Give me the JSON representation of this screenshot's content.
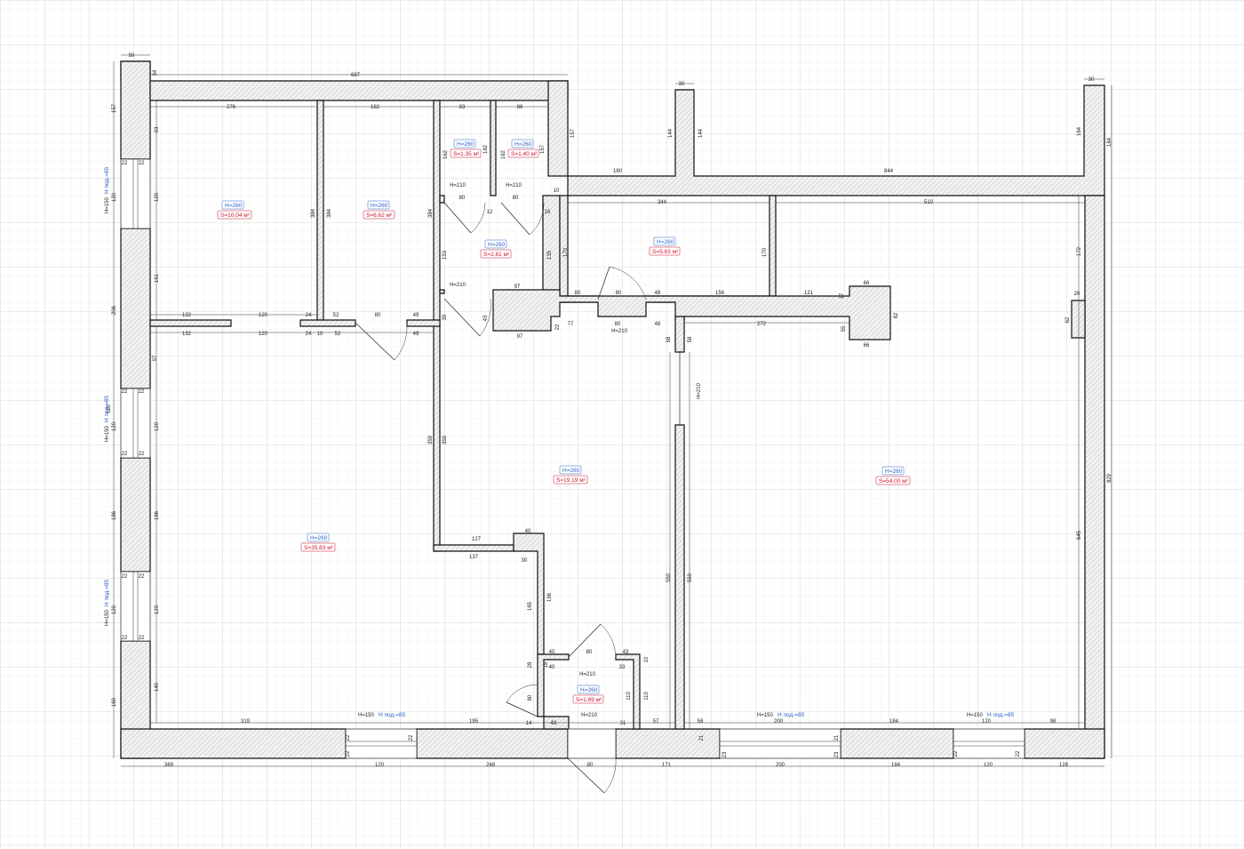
{
  "rooms": [
    {
      "id": "bedroom1",
      "h": "H=260",
      "s": "S=10.04 м²"
    },
    {
      "id": "room2",
      "h": "H=260",
      "s": "S=6.62 м²"
    },
    {
      "id": "wc1",
      "h": "H=260",
      "s": "S=1.35 м²"
    },
    {
      "id": "wc2",
      "h": "H=260",
      "s": "S=1.40 м²"
    },
    {
      "id": "hall-small",
      "h": "H=260",
      "s": "S=2.81 м²"
    },
    {
      "id": "storage",
      "h": "H=260",
      "s": "S=5.83 м²"
    },
    {
      "id": "living",
      "h": "H=260",
      "s": "S=35.83 м²"
    },
    {
      "id": "corridor",
      "h": "H=260",
      "s": "S=19.19 м²"
    },
    {
      "id": "hall-large",
      "h": "H=260",
      "s": "S=54.00 м²"
    },
    {
      "id": "vestibule",
      "h": "H=260",
      "s": "S=1.69 м²"
    }
  ],
  "window_labels": {
    "h150": "H=150",
    "h_sill": "H под.=85"
  },
  "door_height": "H=210",
  "dimensions": [
    "50",
    "34",
    "687",
    "30",
    "30",
    "157",
    "276",
    "182",
    "83",
    "86",
    "157",
    "144",
    "144",
    "164",
    "184",
    "93",
    "162",
    "182",
    "162",
    "157",
    "180",
    "844",
    "22",
    "22",
    "120",
    "120",
    "H=210",
    "H=210",
    "10",
    "384",
    "384",
    "384",
    "80",
    "12",
    "80",
    "16",
    "344",
    "510",
    "153",
    "135",
    "170",
    "170",
    "172",
    "151",
    "H=210",
    "97",
    "80",
    "80",
    "48",
    "156",
    "121",
    "17",
    "66",
    "20",
    "206",
    "132",
    "120",
    "24",
    "52",
    "80",
    "49",
    "82",
    "62",
    "39",
    "43",
    "22",
    "77",
    "80",
    "48",
    "272",
    "55",
    "132",
    "120",
    "24",
    "10",
    "52",
    "49",
    "97",
    "H=210",
    "58",
    "58",
    "66",
    "97",
    "22",
    "22",
    "120",
    "120",
    "120",
    "H=210",
    "22",
    "22",
    "359",
    "359",
    "829",
    "186",
    "186",
    "127",
    "40",
    "137",
    "30",
    "645",
    "22",
    "22",
    "120",
    "120",
    "196",
    "165",
    "550",
    "550",
    "40",
    "80",
    "43",
    "22",
    "22",
    "28",
    "18",
    "40",
    "33",
    "10",
    "H=210",
    "160",
    "140",
    "80",
    "110",
    "110",
    "319",
    "H=210",
    "195",
    "57",
    "58",
    "200",
    "184",
    "120",
    "98",
    "14",
    "43",
    "31",
    "22",
    "22",
    "22",
    "21",
    "23",
    "23",
    "21",
    "22",
    "22",
    "369",
    "120",
    "248",
    "80",
    "171",
    "200",
    "184",
    "120",
    "128"
  ]
}
